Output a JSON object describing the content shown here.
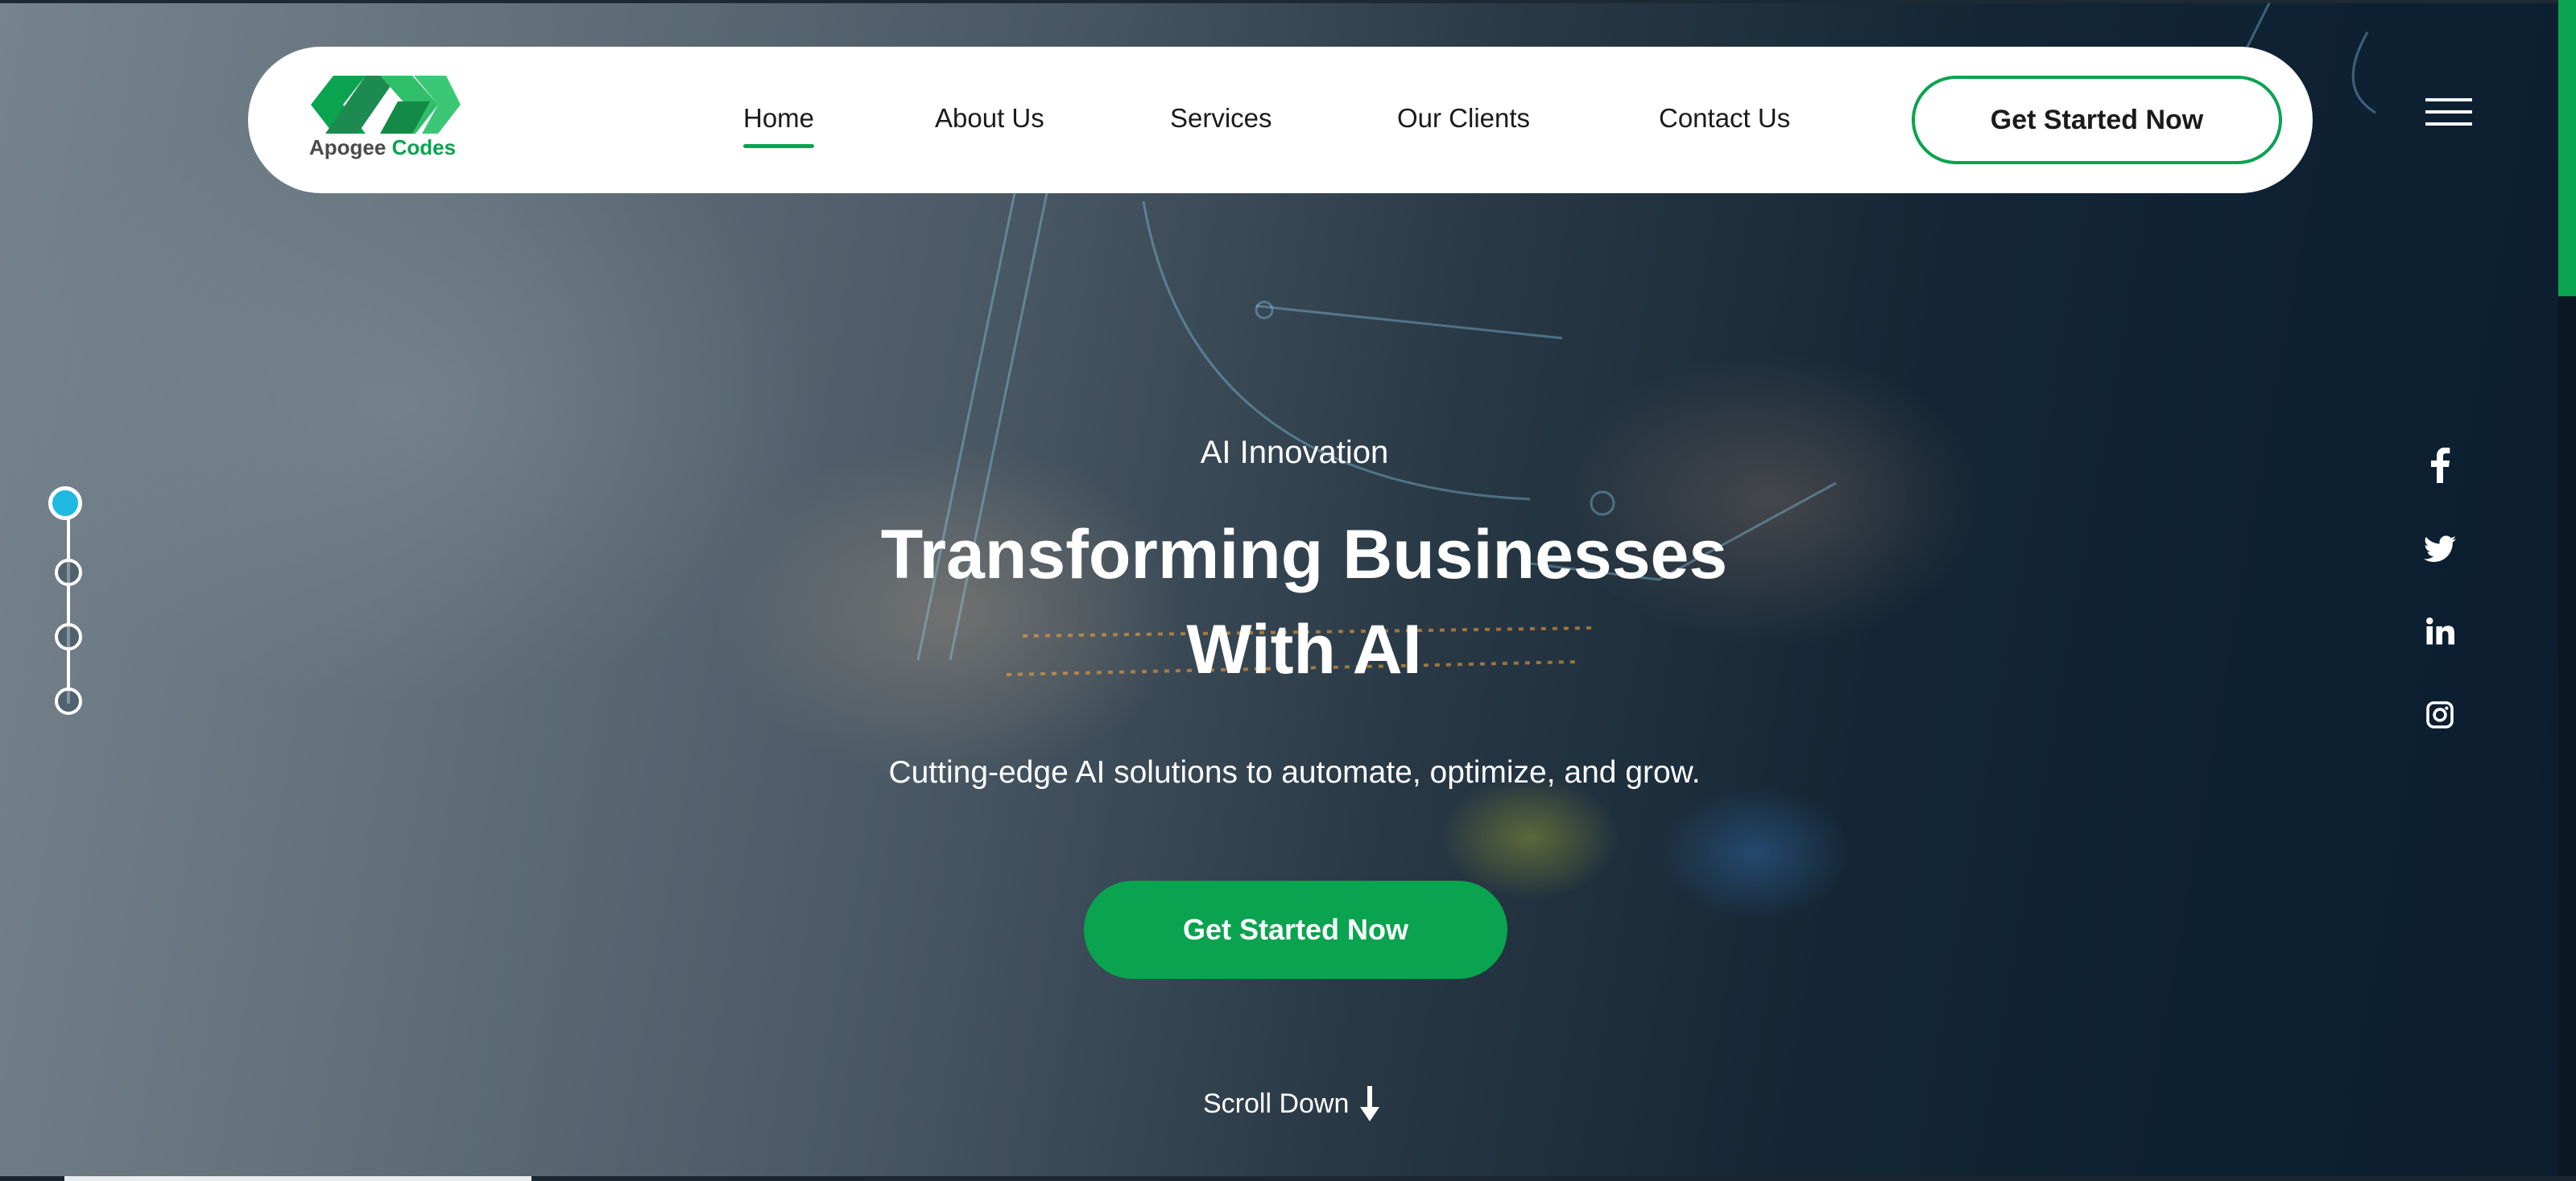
{
  "brand": {
    "name_part1": "Apogee",
    "name_part2": "Codes",
    "accent_color": "#0aa34f"
  },
  "nav": {
    "links": [
      {
        "label": "Home",
        "active": true
      },
      {
        "label": "About Us",
        "active": false
      },
      {
        "label": "Services",
        "active": false
      },
      {
        "label": "Our Clients",
        "active": false
      },
      {
        "label": "Contact Us",
        "active": false
      }
    ],
    "cta_label": "Get Started Now",
    "menu_icon": "hamburger-menu-icon"
  },
  "hero": {
    "eyebrow": "AI Innovation",
    "headline_line1": "Transforming Businesses",
    "headline_line2": "With AI",
    "subheadline": "Cutting-edge AI solutions to automate, optimize, and grow.",
    "cta_label": "Get Started Now",
    "scroll_label": "Scroll Down",
    "scroll_icon": "arrow-down-icon"
  },
  "slider": {
    "total_slides": 4,
    "active_slide": 1,
    "active_color": "#1fb8e0"
  },
  "social": {
    "icons": [
      "facebook-icon",
      "twitter-icon",
      "linkedin-icon",
      "instagram-icon"
    ]
  }
}
